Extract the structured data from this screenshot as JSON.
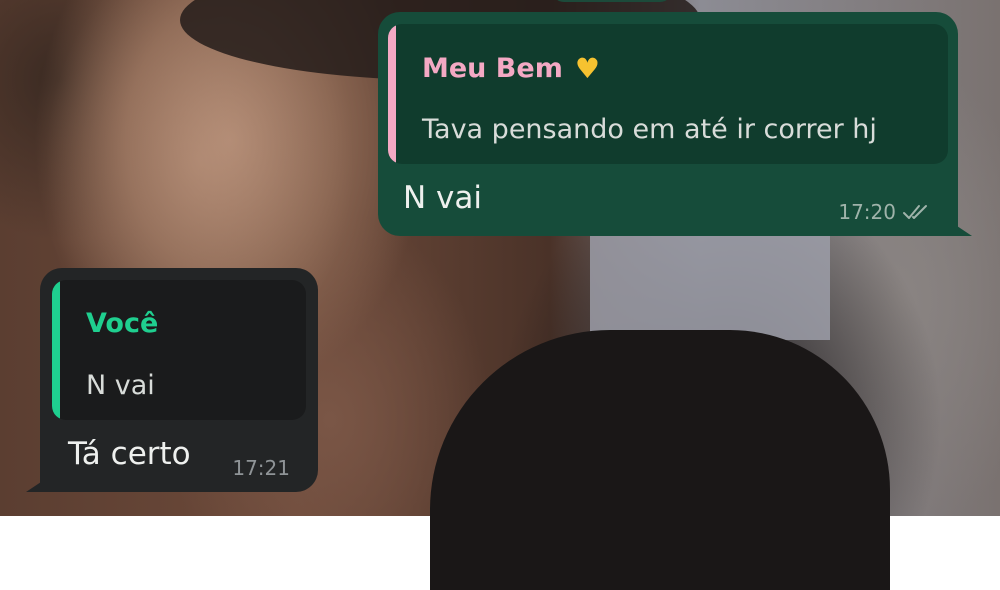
{
  "colors": {
    "outgoing_bubble": "#164c3a",
    "incoming_bubble": "#232526",
    "outgoing_quote_bar": "#f4a9c4",
    "outgoing_quote_author": "#f4a9c4",
    "incoming_quote_bar": "#1fcf8f",
    "incoming_quote_author": "#1fcf8f",
    "heart_emoji": "#f6c230"
  },
  "messages": [
    {
      "direction": "outgoing",
      "quote": {
        "author": "Meu Bem",
        "author_emoji_icon": "yellow-heart-icon",
        "text": "Tava pensando em até ir correr hj"
      },
      "text": "N vai",
      "time": "17:20",
      "status_icon": "double-check-icon"
    },
    {
      "direction": "incoming",
      "quote": {
        "author": "Você",
        "text": "N vai"
      },
      "text": "Tá certo",
      "time": "17:21"
    }
  ]
}
